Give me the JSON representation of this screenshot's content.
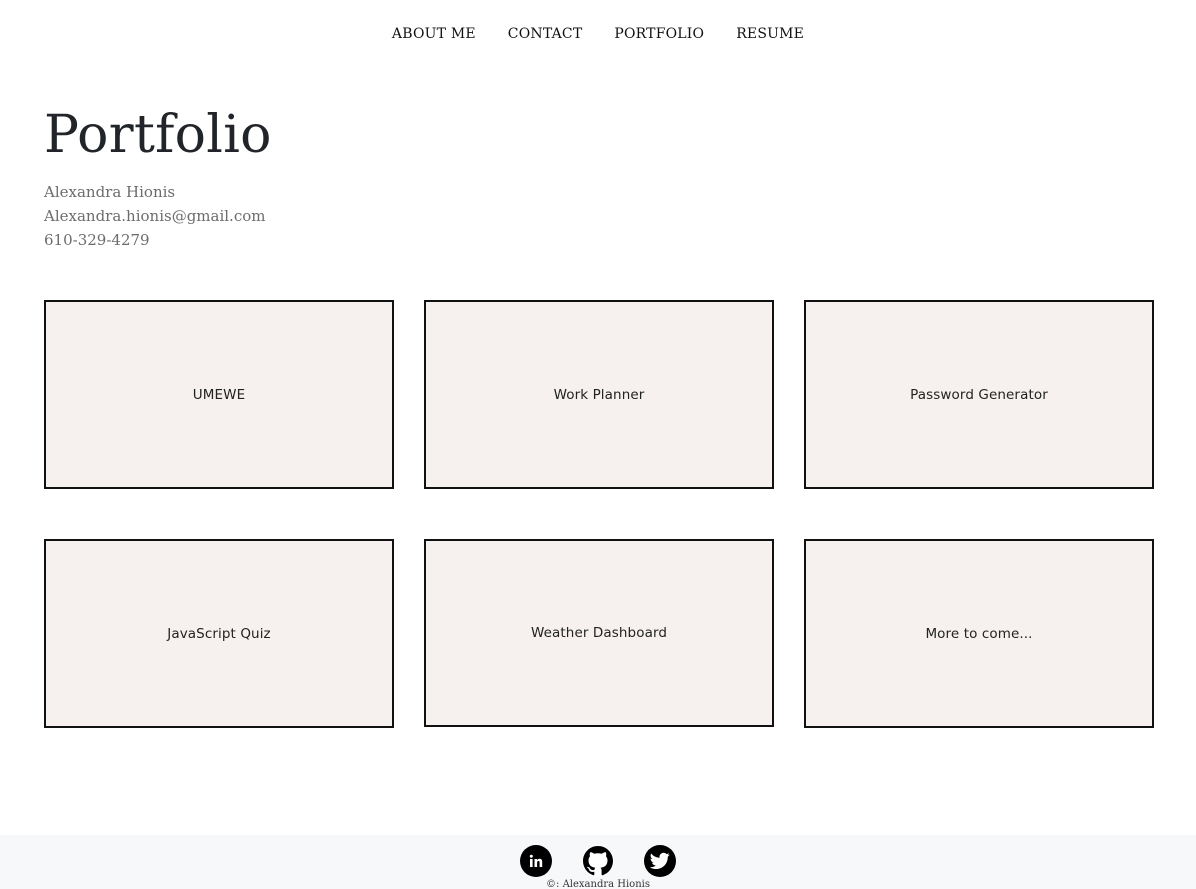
{
  "nav": {
    "items": [
      {
        "label": "ABOUT ME"
      },
      {
        "label": "CONTACT"
      },
      {
        "label": "PORTFOLIO"
      },
      {
        "label": "RESUME"
      }
    ]
  },
  "header": {
    "title": "Portfolio",
    "name": "Alexandra Hionis",
    "email": "Alexandra.hionis@gmail.com",
    "phone": "610-329-4279"
  },
  "projects": [
    {
      "label": "UMEWE"
    },
    {
      "label": "Work Planner"
    },
    {
      "label": "Password Generator"
    },
    {
      "label": "JavaScript Quiz"
    },
    {
      "label": "Weather Dashboard"
    },
    {
      "label": "More to come..."
    }
  ],
  "footer": {
    "social": [
      {
        "icon": "linkedin-icon"
      },
      {
        "icon": "github-icon"
      },
      {
        "icon": "twitter-icon"
      }
    ],
    "copyright": "©: Alexandra Hionis"
  },
  "colors": {
    "card_background": "#f6f1ee",
    "card_border": "#111111",
    "footer_background": "#f7f8fa",
    "icon_background": "#000000"
  }
}
